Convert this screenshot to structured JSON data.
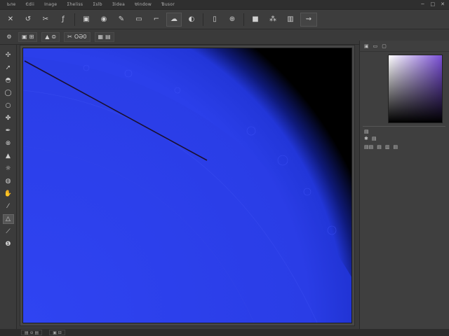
{
  "menubar": {
    "items": [
      "Ьле",
      "Єdii",
      "Ιnage",
      "Ʃheliss",
      "Ʃslb",
      "Ǝidea",
      "Ʉindow",
      "Ɓusor"
    ],
    "window_controls": [
      "−",
      "□",
      "✕"
    ]
  },
  "toolbar": {
    "buttons": [
      {
        "name": "close-doc-icon",
        "glyph": "✕"
      },
      {
        "name": "rotate-icon",
        "glyph": "↺"
      },
      {
        "name": "scissors-icon",
        "glyph": "✂"
      },
      {
        "name": "font-icon",
        "glyph": "ƒ"
      },
      {
        "name": "layers-icon",
        "glyph": "▣"
      },
      {
        "name": "globe-icon",
        "glyph": "◉"
      },
      {
        "name": "brush-settings-icon",
        "glyph": "✎"
      },
      {
        "name": "frame-icon",
        "glyph": "▭"
      },
      {
        "name": "crop-icon",
        "glyph": "⌐"
      },
      {
        "name": "paint-icon",
        "glyph": "☁"
      },
      {
        "name": "eye-icon",
        "glyph": "◐"
      },
      {
        "name": "panel-icon",
        "glyph": "▯"
      },
      {
        "name": "transform-icon",
        "glyph": "⊕"
      },
      {
        "name": "square-icon",
        "glyph": "■"
      },
      {
        "name": "spray-icon",
        "glyph": "⁂"
      },
      {
        "name": "histogram-icon",
        "glyph": "▥"
      },
      {
        "name": "path-icon",
        "glyph": "⇝"
      }
    ]
  },
  "options_bar": {
    "settings_glyph": "⚙",
    "chip1_glyph": "▣",
    "chip1_label": "⊞",
    "chip2_glyph": "▲",
    "chip2_label": "⊜",
    "chip3_glyph": "✂",
    "chip3_label": "OƏ0",
    "chip4_glyph": "▦",
    "chip4_label": "▤"
  },
  "tools": [
    {
      "name": "move-tool-icon",
      "glyph": "✣"
    },
    {
      "name": "arrow-tool-icon",
      "glyph": "➚"
    },
    {
      "name": "bucket-tool-icon",
      "glyph": "◓"
    },
    {
      "name": "lasso-tool-icon",
      "glyph": "◯"
    },
    {
      "name": "ring-tool-icon",
      "glyph": "○"
    },
    {
      "name": "blob-tool-icon",
      "glyph": "✤"
    },
    {
      "name": "pen-tool-icon",
      "glyph": "✒"
    },
    {
      "name": "stamp-tool-icon",
      "glyph": "⊗"
    },
    {
      "name": "fill-tool-icon",
      "glyph": "▲"
    },
    {
      "name": "smudge-tool-icon",
      "glyph": "☼"
    },
    {
      "name": "lens-tool-icon",
      "glyph": "◍"
    },
    {
      "name": "hand-tool-icon",
      "glyph": "✋"
    },
    {
      "name": "dropper-tool-icon",
      "glyph": "⁄"
    },
    {
      "name": "triangle-tool-icon",
      "glyph": "△"
    },
    {
      "name": "brush-tool-icon",
      "glyph": "⟋"
    },
    {
      "name": "info-tool-icon",
      "glyph": "❶"
    }
  ],
  "right_panel": {
    "head_items": [
      "▣",
      "▭",
      "▢"
    ],
    "row1": [
      "▤"
    ],
    "row2": [
      "✱",
      "▤"
    ],
    "row3_glyphs": [
      "▤▤",
      "▤",
      "▥",
      "▤"
    ]
  },
  "status_bar": {
    "tab1": "▤ ⊖ ▤",
    "tab2": "▣ ⊟"
  },
  "colors": {
    "canvas_fill": "#2b3fea",
    "canvas_bg": "#000000",
    "accent": "#7a4fd6"
  }
}
